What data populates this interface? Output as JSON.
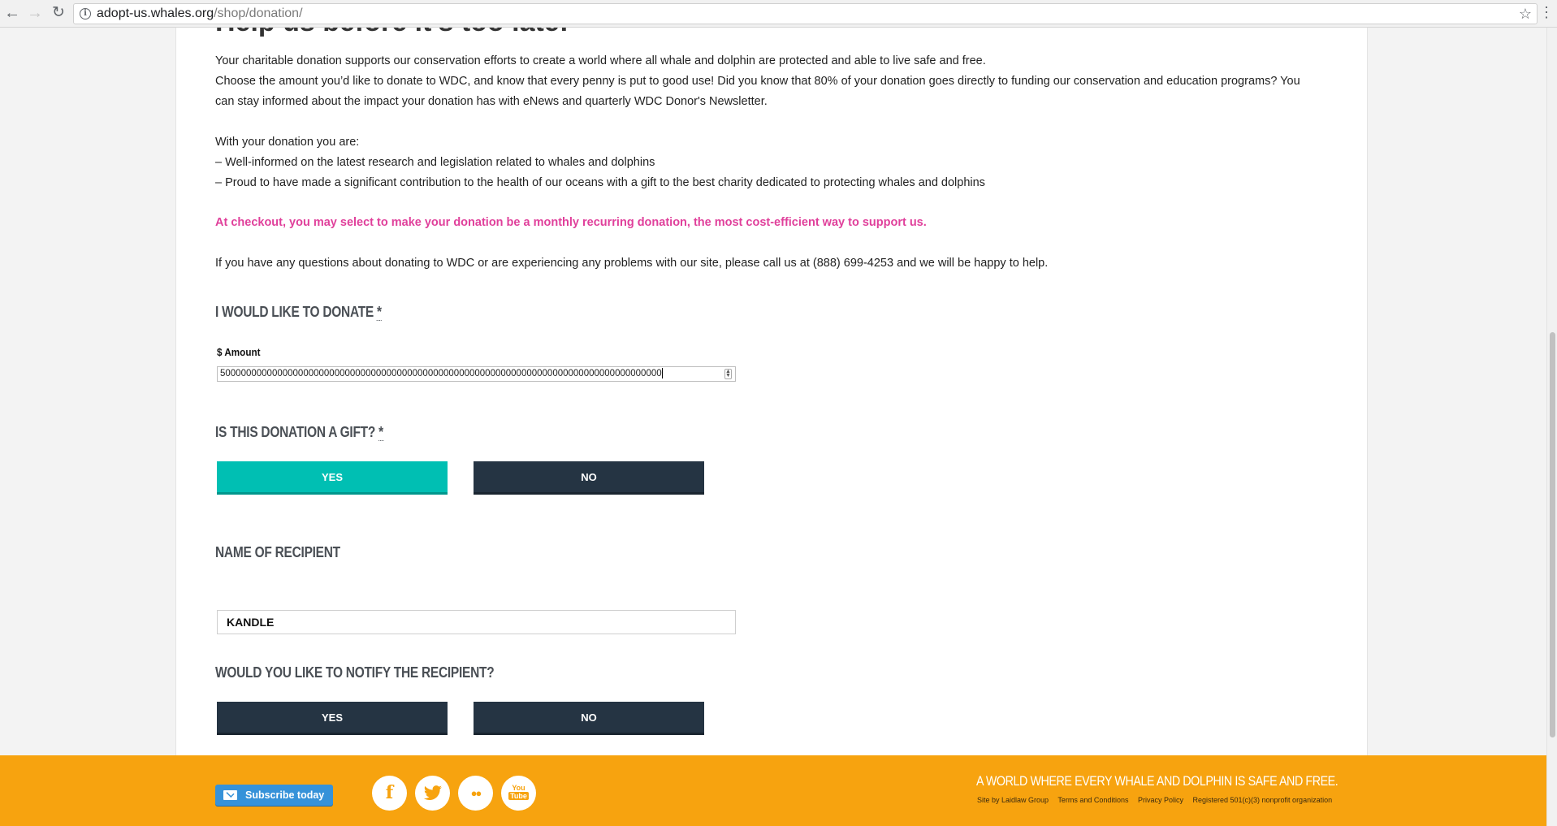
{
  "browser": {
    "url_host": "adopt-us.whales.org",
    "url_path": "/shop/donation/"
  },
  "page": {
    "cut_heading": "Help us before it's too late!",
    "intro_1": "Your charitable donation supports our conservation efforts to create a world where all whale and dolphin are protected and able to live safe and free.",
    "intro_2": "Choose the amount you’d like to donate to WDC, and know that every penny is put to good use! Did you know that 80% of your donation goes directly to funding our conservation and education programs? You can stay informed about the impact your donation has with eNews and quarterly WDC Donor's Newsletter.",
    "benefits_heading": "With your donation you are:",
    "benefit_1": "– Well-informed on the latest research and legislation related to whales and dolphins",
    "benefit_2": "– Proud to have made a significant contribution to the health of our oceans with a gift to the best charity dedicated to protecting whales and dolphins",
    "recurring_note": "At checkout, you may select to make your donation be a monthly recurring donation, the most cost-efficient way to support us.",
    "contact_note": "If you have any questions about donating to WDC or are experiencing any problems with our site, please call us at (888) 699-4253 and we will be happy to help."
  },
  "form": {
    "donate_label": "I WOULD LIKE TO DONATE",
    "required_mark": "*",
    "amount_label": "$ Amount",
    "amount_value": "5000000000000000000000000000000000000000000000000000000000000000000000000000000000000",
    "gift_label": "IS THIS DONATION A GIFT?",
    "gift_yes": "YES",
    "gift_no": "NO",
    "gift_selected": "YES",
    "recipient_label": "NAME OF RECIPIENT",
    "recipient_value": "KANDLE",
    "notify_label": "WOULD YOU LIKE TO NOTIFY THE RECIPIENT?",
    "notify_yes": "YES",
    "notify_no": "NO"
  },
  "footer": {
    "subscribe_label": "Subscribe today",
    "social": [
      "facebook-icon",
      "twitter-icon",
      "flickr-icon",
      "youtube-icon"
    ],
    "tagline": "A WORLD WHERE EVERY WHALE AND DOLPHIN IS SAFE AND FREE.",
    "links": [
      "Site by Laidlaw Group",
      "Terms and Conditions",
      "Privacy Policy",
      "Registered 501(c)(3) nonprofit organization"
    ]
  },
  "colors": {
    "accent_teal": "#00bfb3",
    "dark_button": "#253443",
    "footer_orange": "#f7a30f",
    "highlight_pink": "#e0409b"
  }
}
